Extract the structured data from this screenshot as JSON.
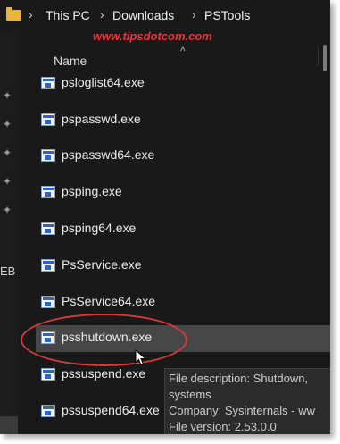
{
  "breadcrumb": [
    "This PC",
    "Downloads",
    "PSTools"
  ],
  "watermark": "www.tipsdotcom.com",
  "column_header": "Name",
  "nav": {
    "partial_text": "EB-"
  },
  "files": [
    "psloglist64.exe",
    "pspasswd.exe",
    "pspasswd64.exe",
    "psping.exe",
    "psping64.exe",
    "PsService.exe",
    "PsService64.exe",
    "psshutdown.exe",
    "pssuspend.exe",
    "pssuspend64.exe"
  ],
  "selected_file": "psshutdown.exe",
  "tooltip": {
    "line1": "File description: Shutdown,",
    "line2": "systems",
    "line3": "Company: Sysinternals - ww",
    "line4": "File version: 2.53.0.0"
  },
  "colors": {
    "highlight_ring": "#d33b3b",
    "watermark": "#e8343a",
    "folder": "#e8b53a"
  }
}
